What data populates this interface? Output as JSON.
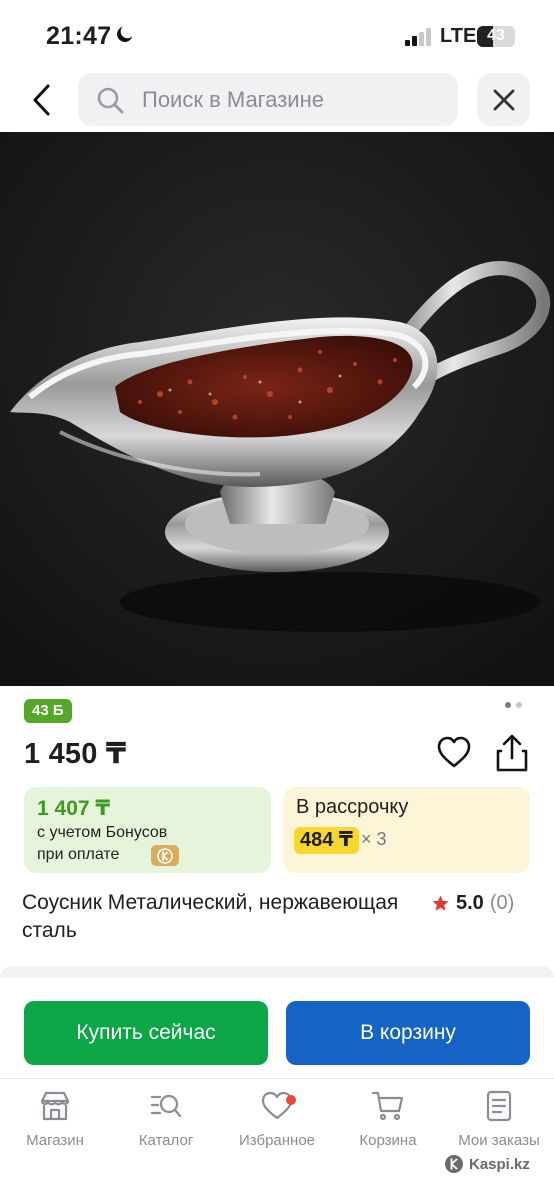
{
  "status_bar": {
    "time": "21:47",
    "network": "LTE",
    "battery_percent": 43,
    "battery_label": "43"
  },
  "header": {
    "search_placeholder": "Поиск в Магазине"
  },
  "product": {
    "bonus_badge": "43 Б",
    "image_count": 2,
    "active_image_index": 0,
    "price": "1 450 ₸",
    "bonus_price": "1 407 ₸",
    "bonus_line1": "с учетом Бонусов",
    "bonus_line2": "при оплате",
    "installment_title": "В рассрочку",
    "installment_amount": "484 ₸",
    "installment_times": "× 3",
    "title": "Соусник Металический, нержавеющая сталь",
    "rating_value": "5.0",
    "rating_count": "(0)"
  },
  "actions": {
    "buy_now": "Купить сейчас",
    "to_cart": "В корзину"
  },
  "nav": {
    "items": [
      {
        "label": "Магазин",
        "icon": "store-icon"
      },
      {
        "label": "Каталог",
        "icon": "catalog-icon"
      },
      {
        "label": "Избранное",
        "icon": "heart-icon",
        "has_notification": true
      },
      {
        "label": "Корзина",
        "icon": "cart-icon"
      },
      {
        "label": "Мои заказы",
        "icon": "orders-icon"
      }
    ]
  },
  "watermark": "Kaspi.kz",
  "colors": {
    "buy_now": "#0ca647",
    "to_cart": "#1463c5",
    "bonus_badge": "#55a629",
    "bonus_card": "#e6f4dc",
    "installment_card": "#fdf5d8",
    "installment_highlight": "#f7d630",
    "rating_star": "#e53935",
    "nav_dot": "#f14635"
  }
}
